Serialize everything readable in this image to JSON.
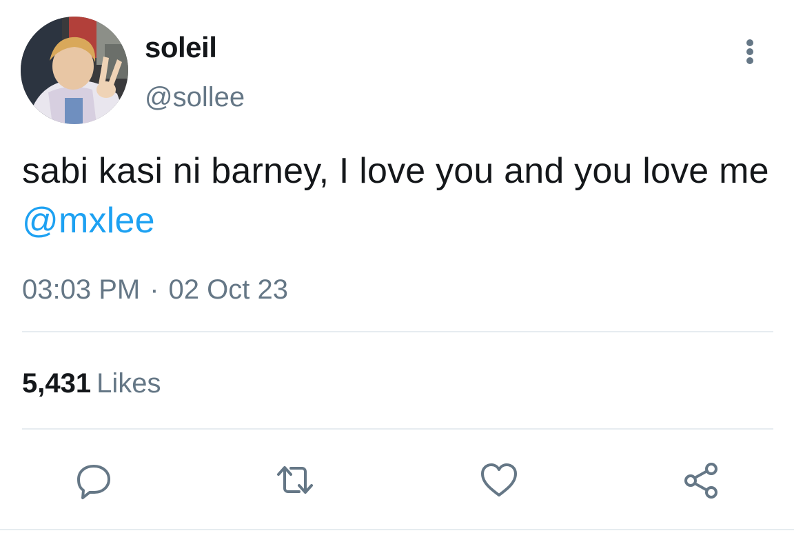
{
  "tweet": {
    "display_name": "soleil",
    "handle": "@sollee",
    "text": "sabi kasi ni barney, I love you and you love me",
    "mention": "@mxlee",
    "time": "03:03 PM",
    "separator": "·",
    "date": "02 Oct 23",
    "likes_count": "5,431",
    "likes_label": "Likes"
  },
  "icons": {
    "more": "more-vertical-icon",
    "reply": "reply-icon",
    "retweet": "retweet-icon",
    "like": "heart-icon",
    "share": "share-icon"
  },
  "colors": {
    "text": "#14171a",
    "secondary": "#657786",
    "link": "#1da1f2",
    "divider": "#e6ecf0"
  }
}
